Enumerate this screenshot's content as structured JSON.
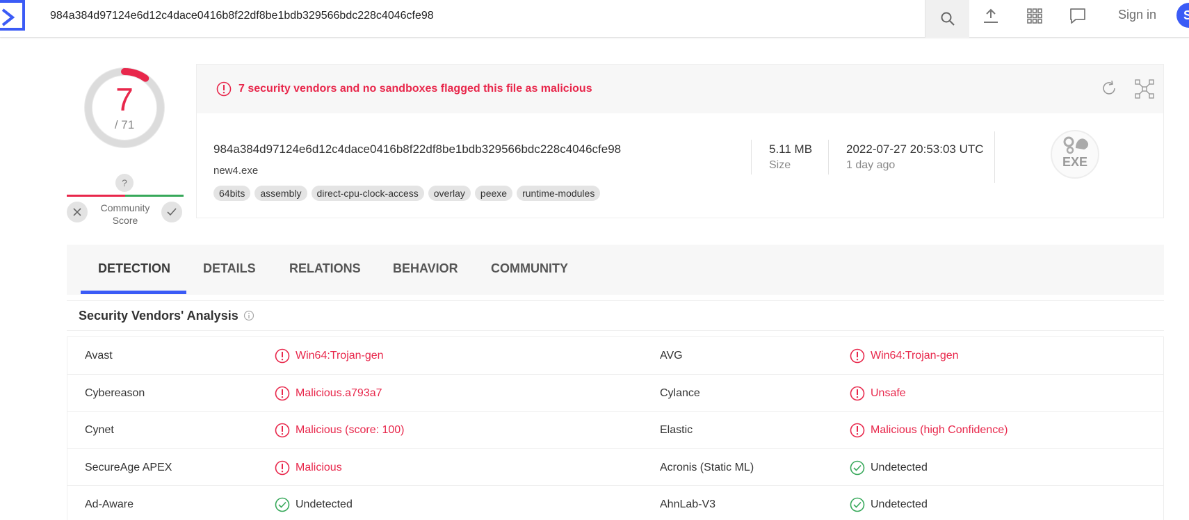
{
  "header": {
    "search_value": "984a384d97124e6d12c4dace0416b8f22df8be1bdb329566bdc228c4046cfe98",
    "sign_in": "Sign in",
    "avatar_letter": "S"
  },
  "score": {
    "detected": "7",
    "total": "/ 71",
    "community_unknown": "?",
    "community_label_line1": "Community",
    "community_label_line2": "Score"
  },
  "alert": {
    "message": "7 security vendors and no sandboxes flagged this file as malicious"
  },
  "file": {
    "hash": "984a384d97124e6d12c4dace0416b8f22df8be1bdb329566bdc228c4046cfe98",
    "name": "new4.exe",
    "tags": [
      "64bits",
      "assembly",
      "direct-cpu-clock-access",
      "overlay",
      "peexe",
      "runtime-modules"
    ],
    "size_value": "5.11 MB",
    "size_label": "Size",
    "date_value": "2022-07-27 20:53:03 UTC",
    "date_relative": "1 day ago",
    "type_label": "EXE"
  },
  "tabs": [
    {
      "label": "DETECTION",
      "active": true
    },
    {
      "label": "DETAILS",
      "active": false
    },
    {
      "label": "RELATIONS",
      "active": false
    },
    {
      "label": "BEHAVIOR",
      "active": false
    },
    {
      "label": "COMMUNITY",
      "active": false
    }
  ],
  "section": {
    "title": "Security Vendors' Analysis"
  },
  "results": [
    {
      "left_vendor": "Avast",
      "left_result": "Win64:Trojan-gen",
      "left_status": "malicious",
      "right_vendor": "AVG",
      "right_result": "Win64:Trojan-gen",
      "right_status": "malicious"
    },
    {
      "left_vendor": "Cybereason",
      "left_result": "Malicious.a793a7",
      "left_status": "malicious",
      "right_vendor": "Cylance",
      "right_result": "Unsafe",
      "right_status": "malicious"
    },
    {
      "left_vendor": "Cynet",
      "left_result": "Malicious (score: 100)",
      "left_status": "malicious",
      "right_vendor": "Elastic",
      "right_result": "Malicious (high Confidence)",
      "right_status": "malicious"
    },
    {
      "left_vendor": "SecureAge APEX",
      "left_result": "Malicious",
      "left_status": "malicious",
      "right_vendor": "Acronis (Static ML)",
      "right_result": "Undetected",
      "right_status": "undetected"
    },
    {
      "left_vendor": "Ad-Aware",
      "left_result": "Undetected",
      "left_status": "undetected",
      "right_vendor": "AhnLab-V3",
      "right_result": "Undetected",
      "right_status": "undetected"
    }
  ],
  "colors": {
    "malicious": "#e8274b",
    "undetected": "#37a85a",
    "accent": "#3b5bf6"
  }
}
